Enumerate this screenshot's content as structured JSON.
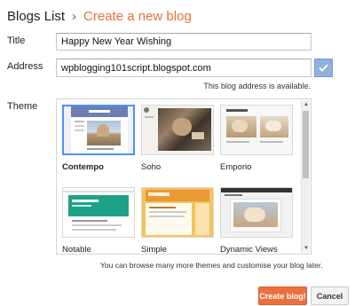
{
  "header": {
    "breadcrumb_link": "Blogs List",
    "separator": "›",
    "title": "Create a new blog"
  },
  "form": {
    "title_label": "Title",
    "title_value": "Happy New Year Wishing",
    "address_label": "Address",
    "address_value": "wpblogging101script.blogspot.com",
    "address_status": "This blog address is available.",
    "theme_label": "Theme"
  },
  "themes": [
    {
      "name": "Contempo",
      "selected": true
    },
    {
      "name": "Soho",
      "selected": false
    },
    {
      "name": "Emporio",
      "selected": false
    },
    {
      "name": "Notable",
      "selected": false
    },
    {
      "name": "Simple",
      "selected": false
    },
    {
      "name": "Dynamic Views",
      "selected": false
    }
  ],
  "browse_note": "You can browse many more themes and customise your blog later.",
  "buttons": {
    "create": "Create blog!",
    "cancel": "Cancel"
  },
  "colors": {
    "accent": "#e8703a",
    "create_button": "#ee6f3e",
    "check_button": "#8eb1de",
    "selected_border": "#4d90fe"
  },
  "icons": {
    "address_check": "checkmark-icon",
    "scroll_up": "scroll-up-arrow-icon",
    "scroll_down": "scroll-down-arrow-icon"
  }
}
